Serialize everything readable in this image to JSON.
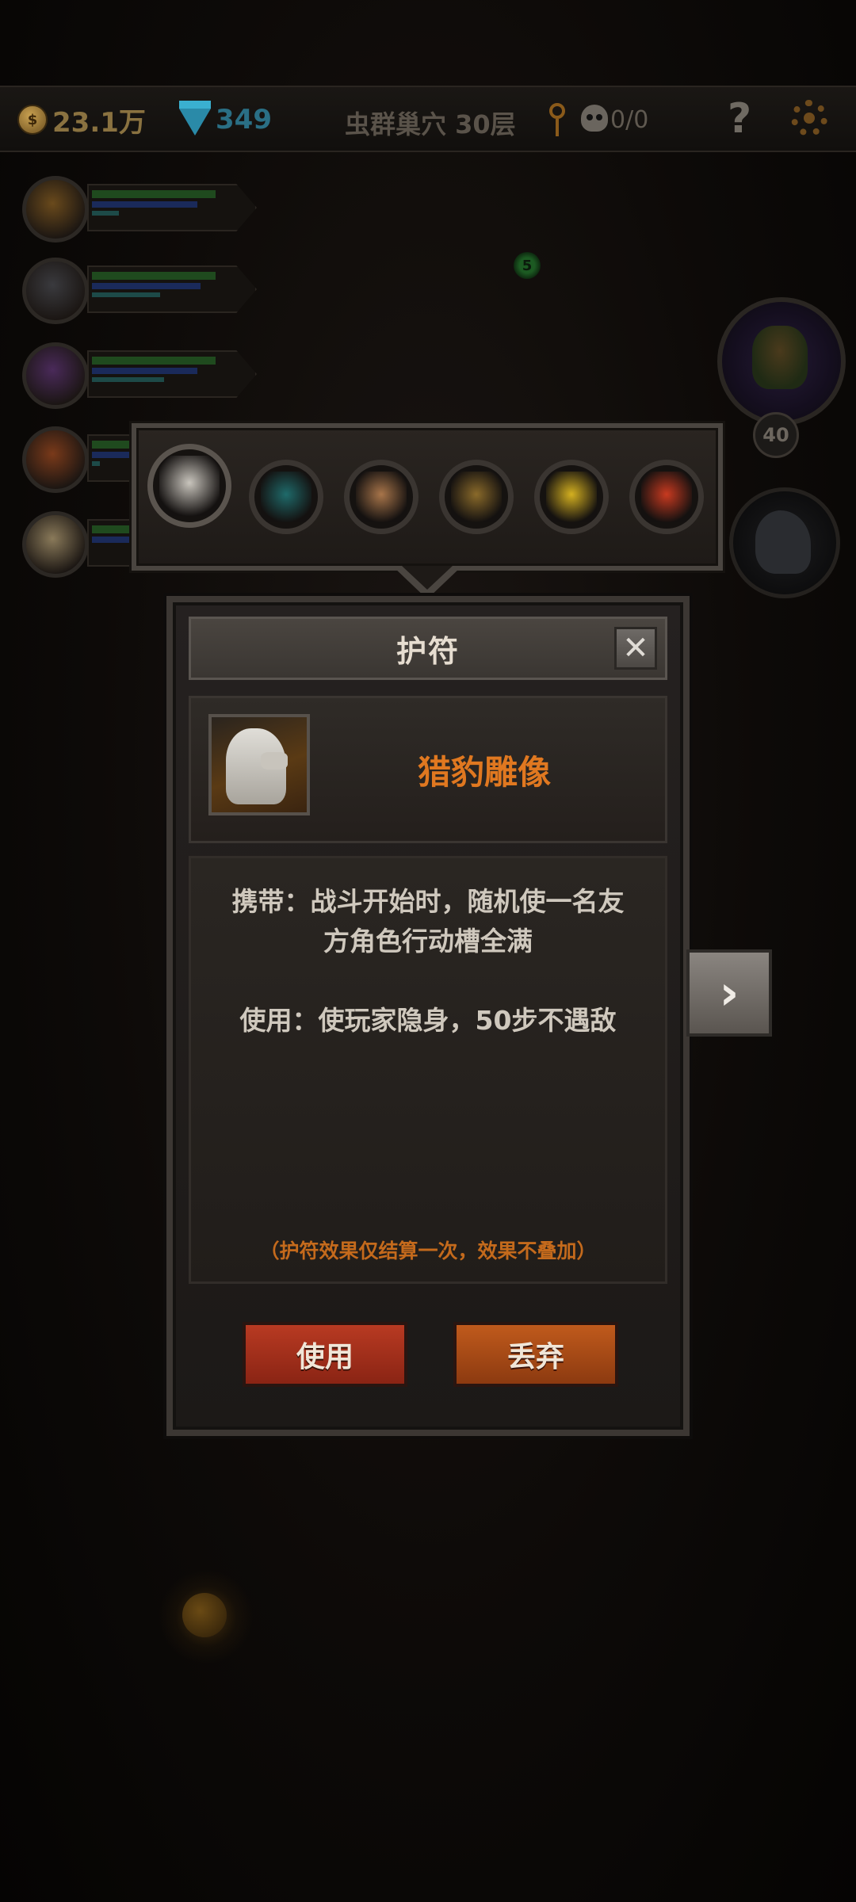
{
  "topbar": {
    "gold": "23.1万",
    "gems": "349",
    "floor": "虫群巢穴 30层",
    "kills": "0/0",
    "help": "?"
  },
  "party": [
    {
      "hp": 0.82,
      "mp": 0.7,
      "xp": 0.18
    },
    {
      "hp": 0.82,
      "mp": 0.72,
      "xp": 0.45
    },
    {
      "hp": 0.82,
      "mp": 0.7,
      "xp": 0.48
    },
    {
      "hp": 0.82,
      "mp": 0.7,
      "xp": 0.05
    },
    {
      "hp": 0.82,
      "mp": 0.7,
      "xp": 0.0
    }
  ],
  "enemy": {
    "level": "40",
    "green_dot": "5"
  },
  "amulets": [
    {
      "icon": "panther-statue-icon",
      "color": "#c9c5bd"
    },
    {
      "icon": "flute-icon",
      "color": "#1f6a6a"
    },
    {
      "icon": "coffin-icon",
      "color": "#a8754a"
    },
    {
      "icon": "bell-icon",
      "color": "#8a6a2a"
    },
    {
      "icon": "golden-feather-icon",
      "color": "#d4b020"
    },
    {
      "icon": "chili-pepper-icon",
      "color": "#c83a20"
    }
  ],
  "panel": {
    "title": "护符",
    "close": "✕",
    "item_name": "猎豹雕像",
    "desc_carry_1": "携带：战斗开始时，随机使一名友",
    "desc_carry_2": "方角色行动槽全满",
    "desc_use": "使用：使玩家隐身，50步不遇敌",
    "note": "（护符效果仅结算一次，效果不叠加）",
    "use_button": "使用",
    "discard_button": "丢弃"
  },
  "next_button": "›",
  "colors": {
    "accent_orange": "#e07820",
    "use_red": "#b83a22",
    "discard_orange": "#c05a1c"
  }
}
